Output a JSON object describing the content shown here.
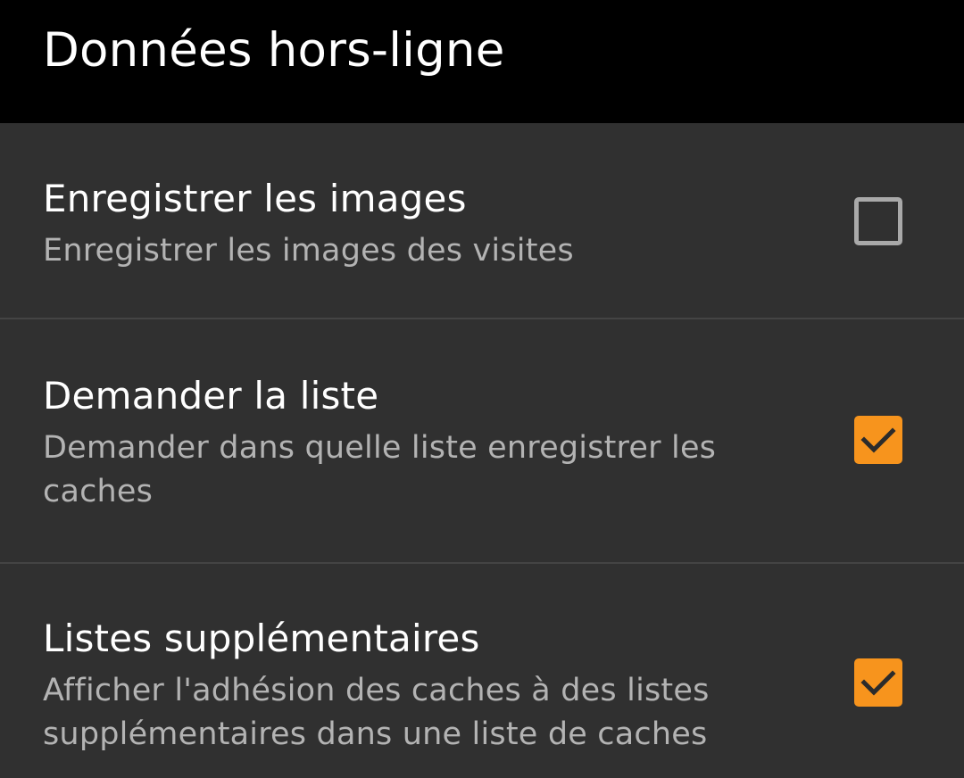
{
  "header": {
    "title": "Données hors-ligne"
  },
  "preferences": [
    {
      "title": "Enregistrer les images",
      "summary": "Enregistrer les images des visites",
      "checked": false
    },
    {
      "title": "Demander la liste",
      "summary": "Demander dans quelle liste enregistrer les caches",
      "checked": true
    },
    {
      "title": "Listes supplémentaires",
      "summary": "Afficher l'adhésion des caches à des listes supplémentaires dans une liste de caches",
      "checked": true
    }
  ],
  "colors": {
    "header_background": "#000000",
    "list_background": "#303030",
    "accent_checkbox": "#f7941d",
    "unchecked_border": "#a9a9a9",
    "divider": "#444444",
    "summary_text": "#b3b3b3"
  },
  "icons": {
    "checked": "check-icon"
  }
}
